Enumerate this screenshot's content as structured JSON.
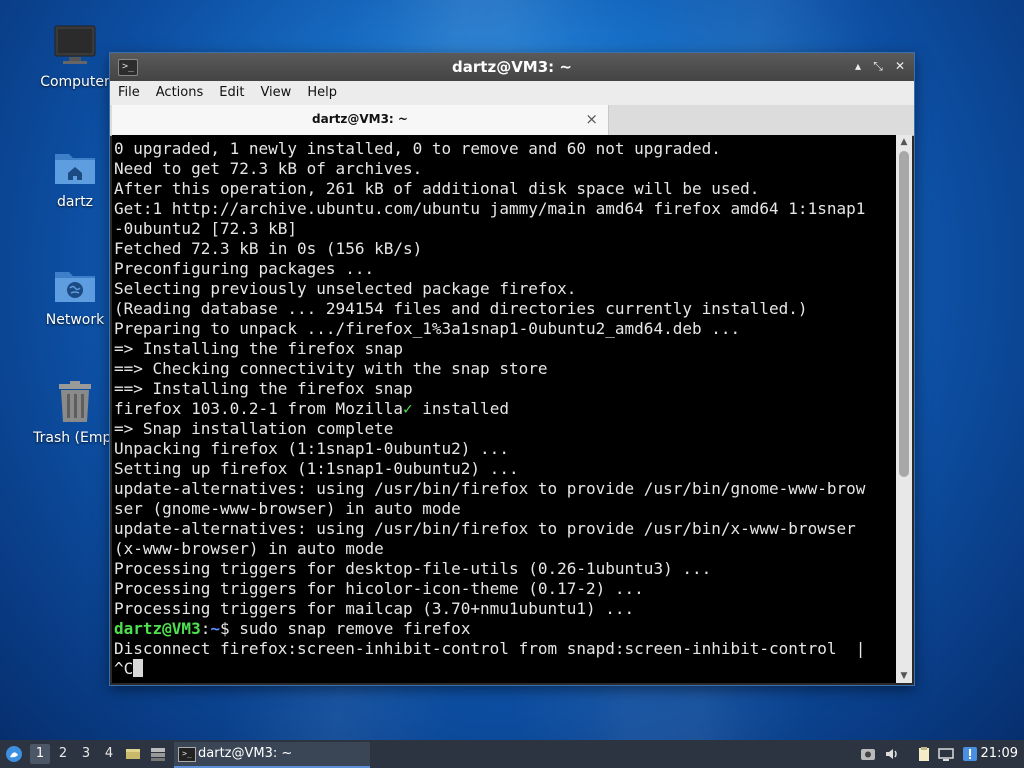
{
  "desktop": {
    "icons": [
      {
        "label": "Computer"
      },
      {
        "label": "dartz"
      },
      {
        "label": "Network"
      },
      {
        "label": "Trash (Empt"
      }
    ]
  },
  "window": {
    "title": "dartz@VM3: ~",
    "menu": [
      "File",
      "Actions",
      "Edit",
      "View",
      "Help"
    ],
    "tab_title": "dartz@VM3: ~",
    "tab_close": "×",
    "controls": {
      "minimize": "▴",
      "maximize": "⤡",
      "close": "✕"
    }
  },
  "terminal": {
    "lines": [
      "0 upgraded, 1 newly installed, 0 to remove and 60 not upgraded.",
      "Need to get 72.3 kB of archives.",
      "After this operation, 261 kB of additional disk space will be used.",
      "Get:1 http://archive.ubuntu.com/ubuntu jammy/main amd64 firefox amd64 1:1snap1",
      "-0ubuntu2 [72.3 kB]",
      "Fetched 72.3 kB in 0s (156 kB/s)",
      "Preconfiguring packages ...",
      "Selecting previously unselected package firefox.",
      "(Reading database ... 294154 files and directories currently installed.)",
      "Preparing to unpack .../firefox_1%3a1snap1-0ubuntu2_amd64.deb ...",
      "=> Installing the firefox snap",
      "==> Checking connectivity with the snap store",
      "==> Installing the firefox snap"
    ],
    "installed_line": {
      "before": "firefox 103.0.2-1 from Mozilla",
      "check": "✓",
      "after": " installed"
    },
    "lines2": [
      "=> Snap installation complete",
      "Unpacking firefox (1:1snap1-0ubuntu2) ...",
      "Setting up firefox (1:1snap1-0ubuntu2) ...",
      "update-alternatives: using /usr/bin/firefox to provide /usr/bin/gnome-www-brow",
      "ser (gnome-www-browser) in auto mode",
      "update-alternatives: using /usr/bin/firefox to provide /usr/bin/x-www-browser",
      "(x-www-browser) in auto mode",
      "Processing triggers for desktop-file-utils (0.26-1ubuntu3) ...",
      "Processing triggers for hicolor-icon-theme (0.17-2) ...",
      "Processing triggers for mailcap (3.70+nmu1ubuntu1) ..."
    ],
    "prompt": {
      "user": "dartz@VM3",
      "sep": ":",
      "path": "~",
      "symbol": "$",
      "command": " sudo snap remove firefox"
    },
    "disconnect_line": "Disconnect firefox:screen-inhibit-control from snapd:screen-inhibit-control  |",
    "interrupt": "^C"
  },
  "taskbar": {
    "workspaces": [
      "1",
      "2",
      "3",
      "4"
    ],
    "active_workspace": "1",
    "task_label": "dartz@VM3: ~",
    "clock": "21:09"
  }
}
